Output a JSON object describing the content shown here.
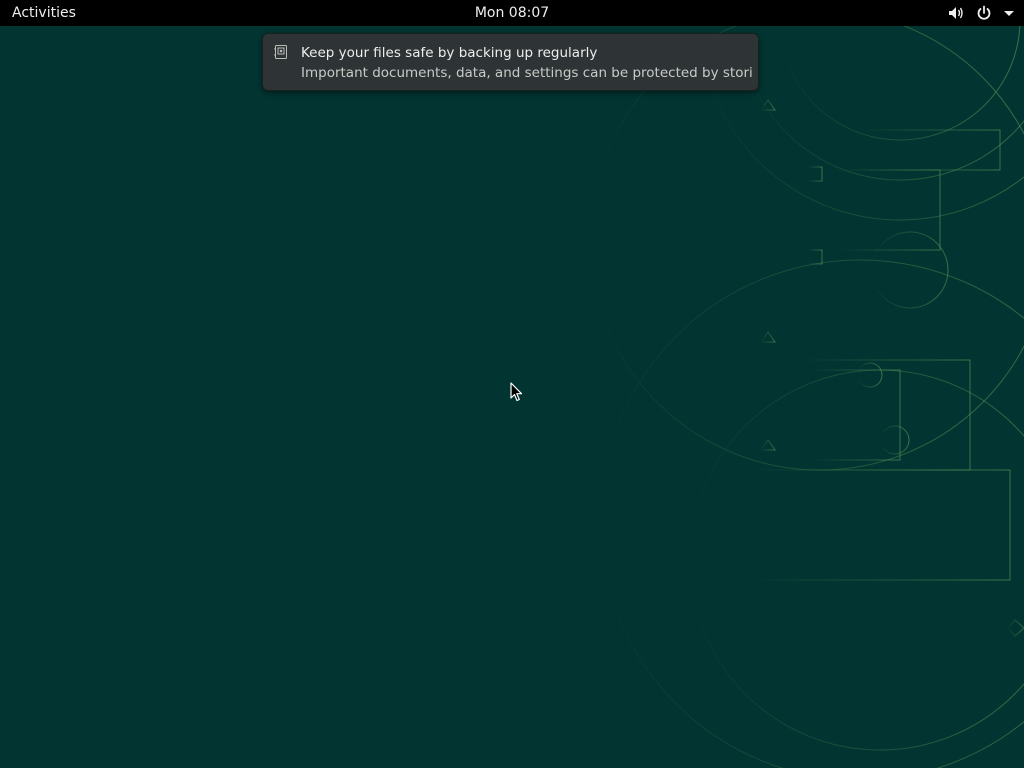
{
  "topbar": {
    "activities_label": "Activities",
    "clock": "Mon 08:07",
    "icons": [
      "volume-icon",
      "power-icon",
      "menu-arrow-icon"
    ]
  },
  "notification": {
    "icon": "backup-icon",
    "title": "Keep your files safe by backing up regularly",
    "body": "Important documents, data, and settings can be protected by storing..."
  },
  "colors": {
    "desktop_bg": "#023531",
    "topbar_bg": "#000000",
    "notification_bg": "#2e3436",
    "wallpaper_lines": "#3f7a4a"
  }
}
